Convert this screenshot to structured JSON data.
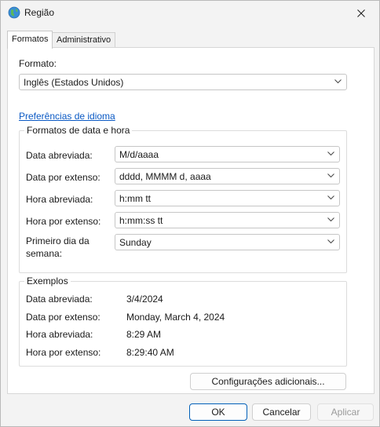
{
  "window": {
    "title": "Região"
  },
  "tabs": [
    {
      "label": "Formatos",
      "active": true
    },
    {
      "label": "Administrativo",
      "active": false
    }
  ],
  "format": {
    "label": "Formato:",
    "selected": "Inglês (Estados Unidos)"
  },
  "language_prefs_link": "Preferências de idioma",
  "date_time_formats": {
    "legend": "Formatos de data e hora",
    "rows": [
      {
        "label": "Data abreviada:",
        "value": "M/d/aaaa"
      },
      {
        "label": "Data por extenso:",
        "value": "dddd, MMMM d, aaaa"
      },
      {
        "label": "Hora abreviada:",
        "value": "h:mm tt"
      },
      {
        "label": "Hora por extenso:",
        "value": "h:mm:ss tt"
      },
      {
        "label_line1": "Primeiro dia da",
        "label_line2": "semana:",
        "value": "Sunday"
      }
    ]
  },
  "examples": {
    "legend": "Exemplos",
    "rows": [
      {
        "label": "Data abreviada:",
        "value": "3/4/2024"
      },
      {
        "label": "Data por extenso:",
        "value": "Monday, March 4, 2024"
      },
      {
        "label": "Hora abreviada:",
        "value": "8:29 AM"
      },
      {
        "label": "Hora por extenso:",
        "value": "8:29:40 AM"
      }
    ]
  },
  "additional_settings_button": "Configurações adicionais...",
  "footer": {
    "ok": "OK",
    "cancel": "Cancelar",
    "apply": "Aplicar"
  },
  "colors": {
    "link": "#0a59c4",
    "primary_border": "#005fb8",
    "window_bg": "#f3f3f3",
    "panel_bg": "#ffffff"
  }
}
